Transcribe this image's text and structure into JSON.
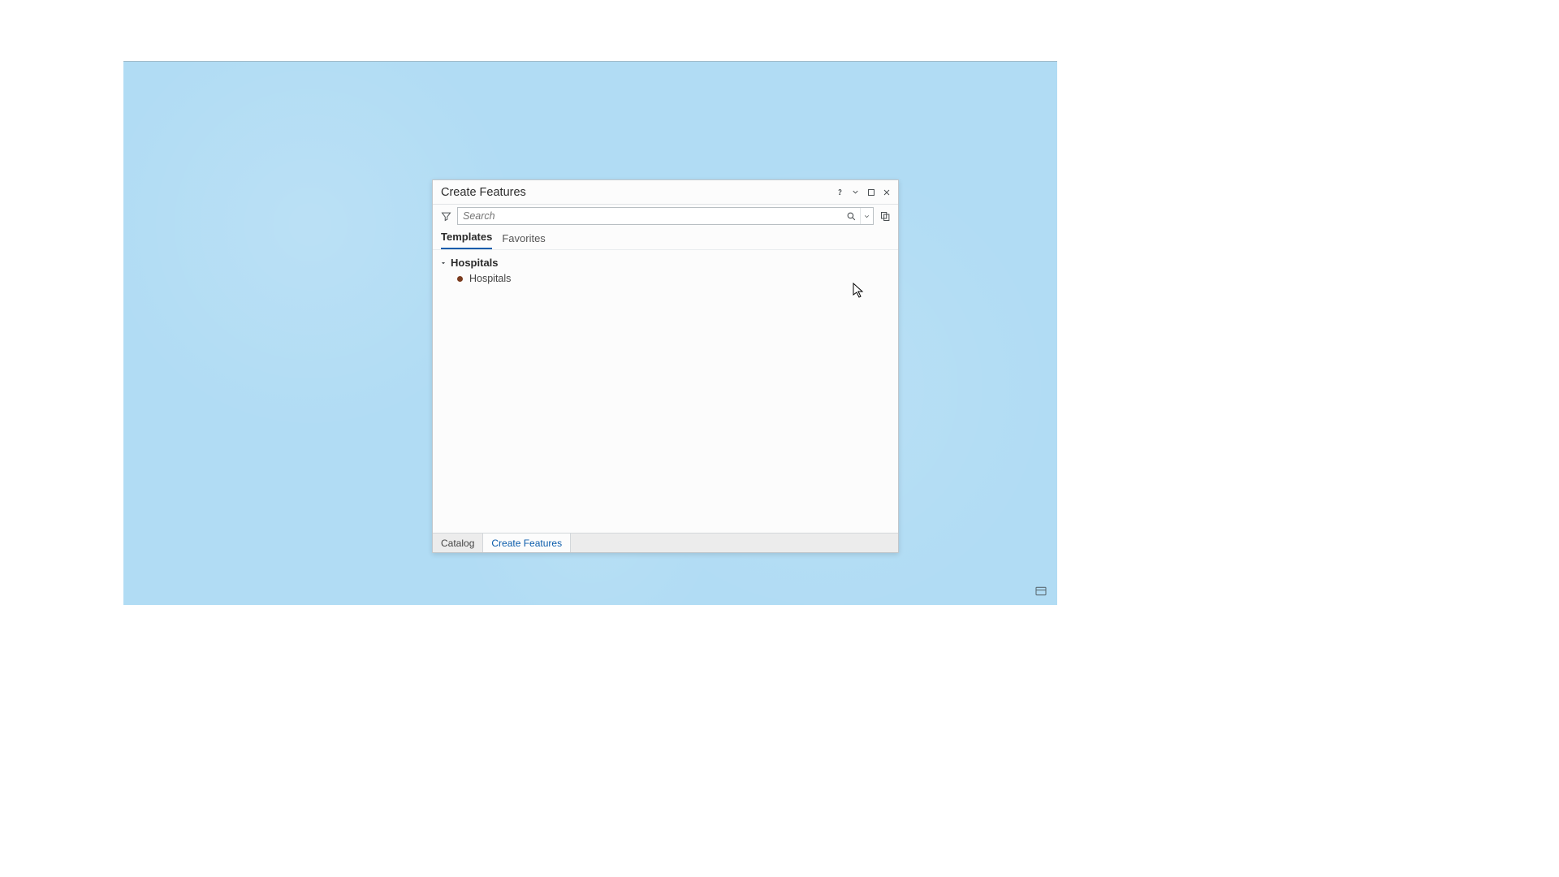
{
  "panel": {
    "title": "Create Features",
    "search": {
      "placeholder": "Search",
      "value": ""
    },
    "tabs": [
      {
        "label": "Templates",
        "active": true
      },
      {
        "label": "Favorites",
        "active": false
      }
    ],
    "group": {
      "header": "Hospitals",
      "items": [
        {
          "label": "Hospitals"
        }
      ]
    },
    "footer_tabs": [
      {
        "label": "Catalog",
        "active": false
      },
      {
        "label": "Create Features",
        "active": true
      }
    ]
  }
}
